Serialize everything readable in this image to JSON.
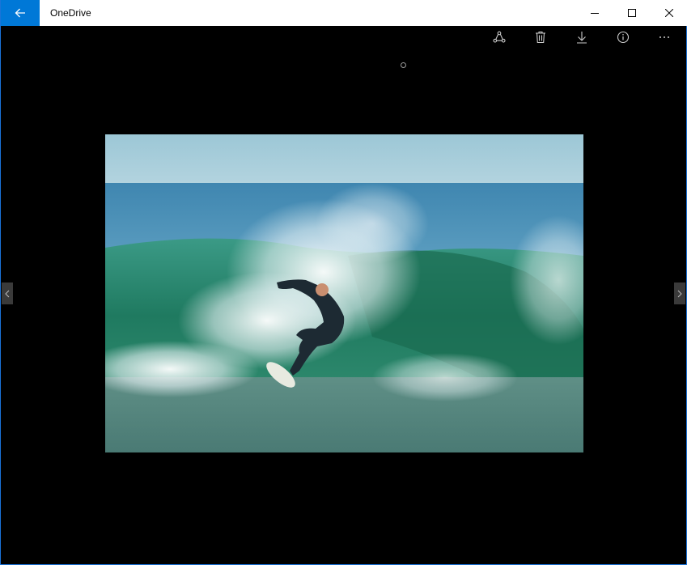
{
  "window": {
    "title": "OneDrive",
    "accent_color": "#0078d7"
  },
  "titlebar": {
    "back_icon": "arrow-left-icon",
    "controls": [
      "minimize-icon",
      "maximize-icon",
      "close-icon"
    ]
  },
  "toolbar": {
    "buttons": [
      "share-icon",
      "delete-icon",
      "download-icon",
      "info-icon",
      "more-icon"
    ],
    "more_label": "···"
  },
  "viewer": {
    "image_subject": "surfer-photo",
    "pager_icon": "page-indicator-dot",
    "prev_icon": "chevron-left-icon",
    "next_icon": "chevron-right-icon"
  }
}
